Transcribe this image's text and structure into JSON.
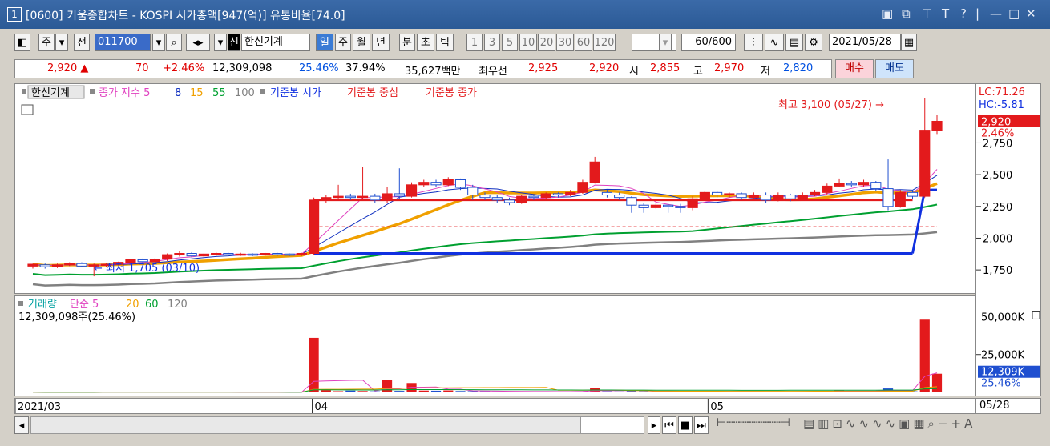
{
  "title": {
    "num": "1",
    "text": "[0600] 키움종합차트 - KOSPI 시가총액[947(억)] 유통비율[74.0]"
  },
  "toolbar": {
    "ju": "주",
    "jeon": "전",
    "code": "011700",
    "stock_name": "한신기계",
    "period_tabs": [
      "일",
      "주",
      "월",
      "년",
      "분",
      "초",
      "틱"
    ],
    "minutes": [
      "1",
      "3",
      "5",
      "10",
      "20",
      "30",
      "60",
      "120"
    ],
    "count": "60/600",
    "date": "2021/05/28"
  },
  "quote": {
    "price": "2,920 ▲",
    "change": "70",
    "rate": "+2.46%",
    "volume": "12,309,098",
    "turnover": "25.46%",
    "ratio2": "37.94%",
    "amount": "35,627백만",
    "best_label": "최우선",
    "ask": "2,925",
    "bid": "2,920",
    "open_label": "시",
    "open": "2,855",
    "high_label": "고",
    "high": "2,970",
    "low_label": "저",
    "low": "2,820",
    "buy": "매수",
    "sell": "매도"
  },
  "legend": {
    "name": "한신기계",
    "close_ma": "종가 지수 5",
    "ma8": "8",
    "ma15": "15",
    "ma55": "55",
    "ma100": "100",
    "base_open": "기준봉 시가",
    "base_mid": "기준봉 중심",
    "base_close": "기준봉 종가"
  },
  "annotations": {
    "high": "최고 3,100 (05/27) →",
    "low": "← 최저 1,705 (03/10)",
    "lc": "LC:71.26",
    "hc": "HC:-5.81"
  },
  "price_axis": {
    "current": "2,920",
    "rate": "2.46%",
    "ticks": [
      "2,750",
      "2,500",
      "2,250",
      "2,000",
      "1,750"
    ]
  },
  "volume_legend": {
    "title": "거래량",
    "ma": "단순 5",
    "ma20": "20",
    "ma60": "60",
    "ma120": "120",
    "value": "12,309,098주(25.46%)"
  },
  "volume_axis": {
    "ticks": [
      "50,000K",
      "25,000K"
    ],
    "current": "12,309K",
    "rate": "25.46%"
  },
  "x_axis": {
    "labels": [
      "2021/03",
      "04",
      "05"
    ],
    "right": "05/28"
  },
  "colors": {
    "up": "#e31a1c",
    "down": "#1f4fd0",
    "ma5": "#e040c0",
    "ma8": "#1030c0",
    "ma15": "#f0a000",
    "ma55": "#00a030",
    "ma100": "#808080"
  },
  "chart_data": {
    "type": "candlestick",
    "ylim": [
      1650,
      3150
    ],
    "candles": [
      [
        1780,
        1795,
        1760,
        1800
      ],
      [
        1790,
        1775,
        1760,
        1800
      ],
      [
        1775,
        1790,
        1765,
        1800
      ],
      [
        1790,
        1800,
        1780,
        1810
      ],
      [
        1800,
        1780,
        1770,
        1810
      ],
      [
        1780,
        1790,
        1700,
        1800
      ],
      [
        1790,
        1795,
        1775,
        1805
      ],
      [
        1795,
        1810,
        1790,
        1815
      ],
      [
        1810,
        1830,
        1800,
        1835
      ],
      [
        1830,
        1815,
        1805,
        1840
      ],
      [
        1815,
        1835,
        1805,
        1845
      ],
      [
        1835,
        1870,
        1820,
        1880
      ],
      [
        1870,
        1880,
        1855,
        1900
      ],
      [
        1880,
        1860,
        1850,
        1890
      ],
      [
        1860,
        1875,
        1850,
        1880
      ],
      [
        1875,
        1880,
        1860,
        1890
      ],
      [
        1880,
        1870,
        1860,
        1885
      ],
      [
        1870,
        1875,
        1860,
        1885
      ],
      [
        1875,
        1870,
        1860,
        1880
      ],
      [
        1870,
        1880,
        1860,
        1885
      ],
      [
        1880,
        1875,
        1860,
        1885
      ],
      [
        1875,
        1870,
        1860,
        1880
      ],
      [
        1870,
        1880,
        1860,
        1885
      ],
      [
        1880,
        2300,
        1870,
        2320
      ],
      [
        2300,
        2320,
        2280,
        2340
      ],
      [
        2320,
        2330,
        2300,
        2420
      ],
      [
        2330,
        2320,
        2300,
        2350
      ],
      [
        2320,
        2330,
        2300,
        2560
      ],
      [
        2330,
        2300,
        2280,
        2350
      ],
      [
        2300,
        2350,
        2280,
        2400
      ],
      [
        2350,
        2330,
        2310,
        2550
      ],
      [
        2330,
        2420,
        2320,
        2440
      ],
      [
        2420,
        2440,
        2400,
        2460
      ],
      [
        2440,
        2420,
        2400,
        2460
      ],
      [
        2420,
        2460,
        2410,
        2480
      ],
      [
        2460,
        2400,
        2380,
        2470
      ],
      [
        2400,
        2340,
        2300,
        2420
      ],
      [
        2340,
        2320,
        2300,
        2360
      ],
      [
        2320,
        2300,
        2280,
        2340
      ],
      [
        2300,
        2280,
        2260,
        2320
      ],
      [
        2280,
        2330,
        2270,
        2340
      ],
      [
        2330,
        2320,
        2300,
        2340
      ],
      [
        2320,
        2350,
        2310,
        2360
      ],
      [
        2350,
        2340,
        2320,
        2360
      ],
      [
        2340,
        2360,
        2330,
        2380
      ],
      [
        2360,
        2440,
        2350,
        2460
      ],
      [
        2440,
        2600,
        2430,
        2640
      ],
      [
        2360,
        2340,
        2320,
        2380
      ],
      [
        2340,
        2320,
        2300,
        2360
      ],
      [
        2320,
        2260,
        2200,
        2330
      ],
      [
        2260,
        2240,
        2200,
        2280
      ],
      [
        2240,
        2260,
        2230,
        2280
      ],
      [
        2260,
        2250,
        2200,
        2270
      ],
      [
        2250,
        2240,
        2200,
        2270
      ],
      [
        2240,
        2310,
        2220,
        2330
      ],
      [
        2310,
        2360,
        2300,
        2370
      ],
      [
        2360,
        2340,
        2320,
        2370
      ],
      [
        2340,
        2350,
        2320,
        2360
      ],
      [
        2350,
        2320,
        2300,
        2360
      ],
      [
        2320,
        2340,
        2300,
        2360
      ],
      [
        2340,
        2300,
        2280,
        2360
      ],
      [
        2300,
        2340,
        2290,
        2360
      ],
      [
        2340,
        2310,
        2290,
        2350
      ],
      [
        2310,
        2340,
        2300,
        2360
      ],
      [
        2340,
        2360,
        2330,
        2380
      ],
      [
        2360,
        2410,
        2340,
        2430
      ],
      [
        2410,
        2430,
        2400,
        2470
      ],
      [
        2430,
        2420,
        2400,
        2450
      ],
      [
        2420,
        2440,
        2400,
        2460
      ],
      [
        2440,
        2390,
        2370,
        2450
      ],
      [
        2390,
        2250,
        2220,
        2620
      ],
      [
        2250,
        2360,
        2240,
        2380
      ],
      [
        2360,
        2330,
        2310,
        2380
      ],
      [
        2330,
        2850,
        2320,
        3100
      ],
      [
        2850,
        2920,
        2820,
        2970
      ]
    ],
    "volume_max": 55000,
    "volumes": [
      200,
      150,
      120,
      180,
      160,
      300,
      250,
      150,
      200,
      180,
      220,
      300,
      250,
      200,
      180,
      160,
      150,
      140,
      160,
      150,
      140,
      130,
      150,
      36000,
      1500,
      800,
      1200,
      900,
      700,
      8200,
      1000,
      6200,
      1200,
      1100,
      1300,
      900,
      800,
      700,
      600,
      600,
      500,
      600,
      550,
      500,
      600,
      800,
      3000,
      700,
      600,
      900,
      700,
      500,
      600,
      500,
      800,
      900,
      700,
      600,
      500,
      600,
      500,
      600,
      550,
      600,
      700,
      900,
      1200,
      800,
      700,
      900,
      2600,
      1000,
      700,
      48000,
      12309
    ]
  }
}
